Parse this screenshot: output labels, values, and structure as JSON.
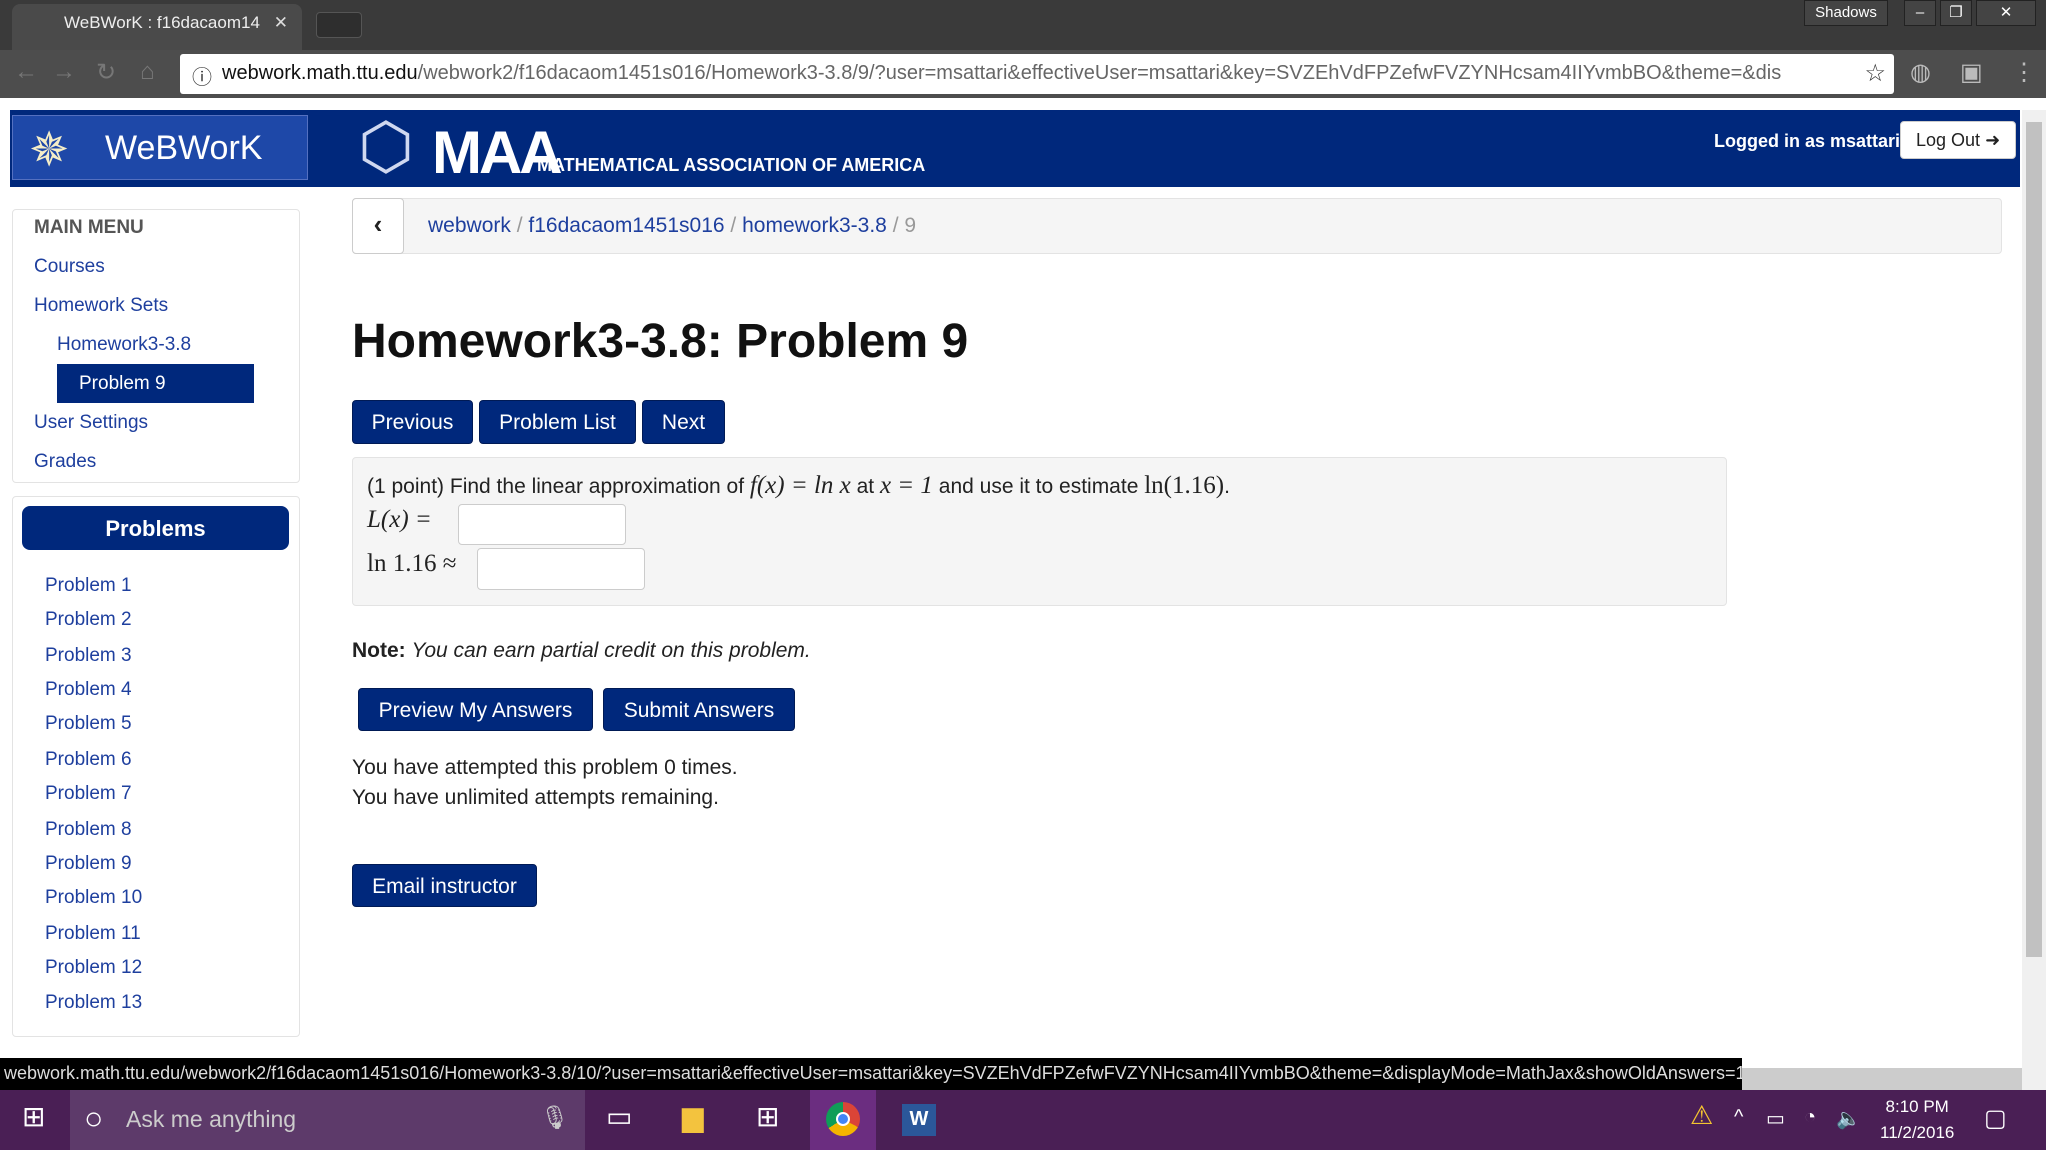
{
  "browser": {
    "tab_title": "WeBWorK : f16dacaom14",
    "profile": "Shadows",
    "url_host": "webwork.math.ttu.edu",
    "url_path": "/webwork2/f16dacaom1451s016/Homework3-3.8/9/?user=msattari&effectiveUser=msattari&key=SVZEhVdFPZefwFVZYNHcsam4IIYvmbBO&theme=&dis",
    "status_url": "webwork.math.ttu.edu/webwork2/f16dacaom1451s016/Homework3-3.8/10/?user=msattari&effectiveUser=msattari&key=SVZEhVdFPZefwFVZYNHcsam4IIYvmbBO&theme=&displayMode=MathJax&showOldAnswers=1"
  },
  "header": {
    "logo": "WeBWorK",
    "maa": "MAA",
    "maa_full": "MATHEMATICAL ASSOCIATION OF AMERICA",
    "logged_in": "Logged in as msattari.",
    "logout": "Log Out"
  },
  "sidebar": {
    "title": "MAIN MENU",
    "courses": "Courses",
    "homework_sets": "Homework Sets",
    "set": "Homework3-3.8",
    "problem": "Problem 9",
    "user_settings": "User Settings",
    "grades": "Grades"
  },
  "problems": {
    "title": "Problems",
    "items": [
      "Problem 1",
      "Problem 2",
      "Problem 3",
      "Problem 4",
      "Problem 5",
      "Problem 6",
      "Problem 7",
      "Problem 8",
      "Problem 9",
      "Problem 10",
      "Problem 11",
      "Problem 12",
      "Problem 13"
    ]
  },
  "breadcrumb": {
    "items": [
      "webwork",
      "f16dacaom1451s016",
      "homework3-3.8"
    ],
    "current": "9",
    "sep": "/"
  },
  "main": {
    "title": "Homework3-3.8: Problem 9",
    "previous": "Previous",
    "problem_list": "Problem List",
    "next": "Next",
    "prob_pre": "(1 point) Find the linear approximation of",
    "f": "f(x) = ln x",
    "at": "at",
    "x1": "x = 1",
    "use": "and use it to estimate",
    "ln116": "ln(1.16)",
    "dot": ".",
    "l_label": "L(x) =",
    "ln_label": "ln 1.16 ≈",
    "l_value": "",
    "ln_value": "",
    "note_label": "Note:",
    "note": "You can earn partial credit on this problem.",
    "preview": "Preview My Answers",
    "submit": "Submit Answers",
    "attempted": "You have attempted this problem 0 times.",
    "remaining": "You have unlimited attempts remaining.",
    "email": "Email instructor"
  },
  "taskbar": {
    "search": "Ask me anything",
    "time": "8:10 PM",
    "date": "11/2/2016"
  }
}
